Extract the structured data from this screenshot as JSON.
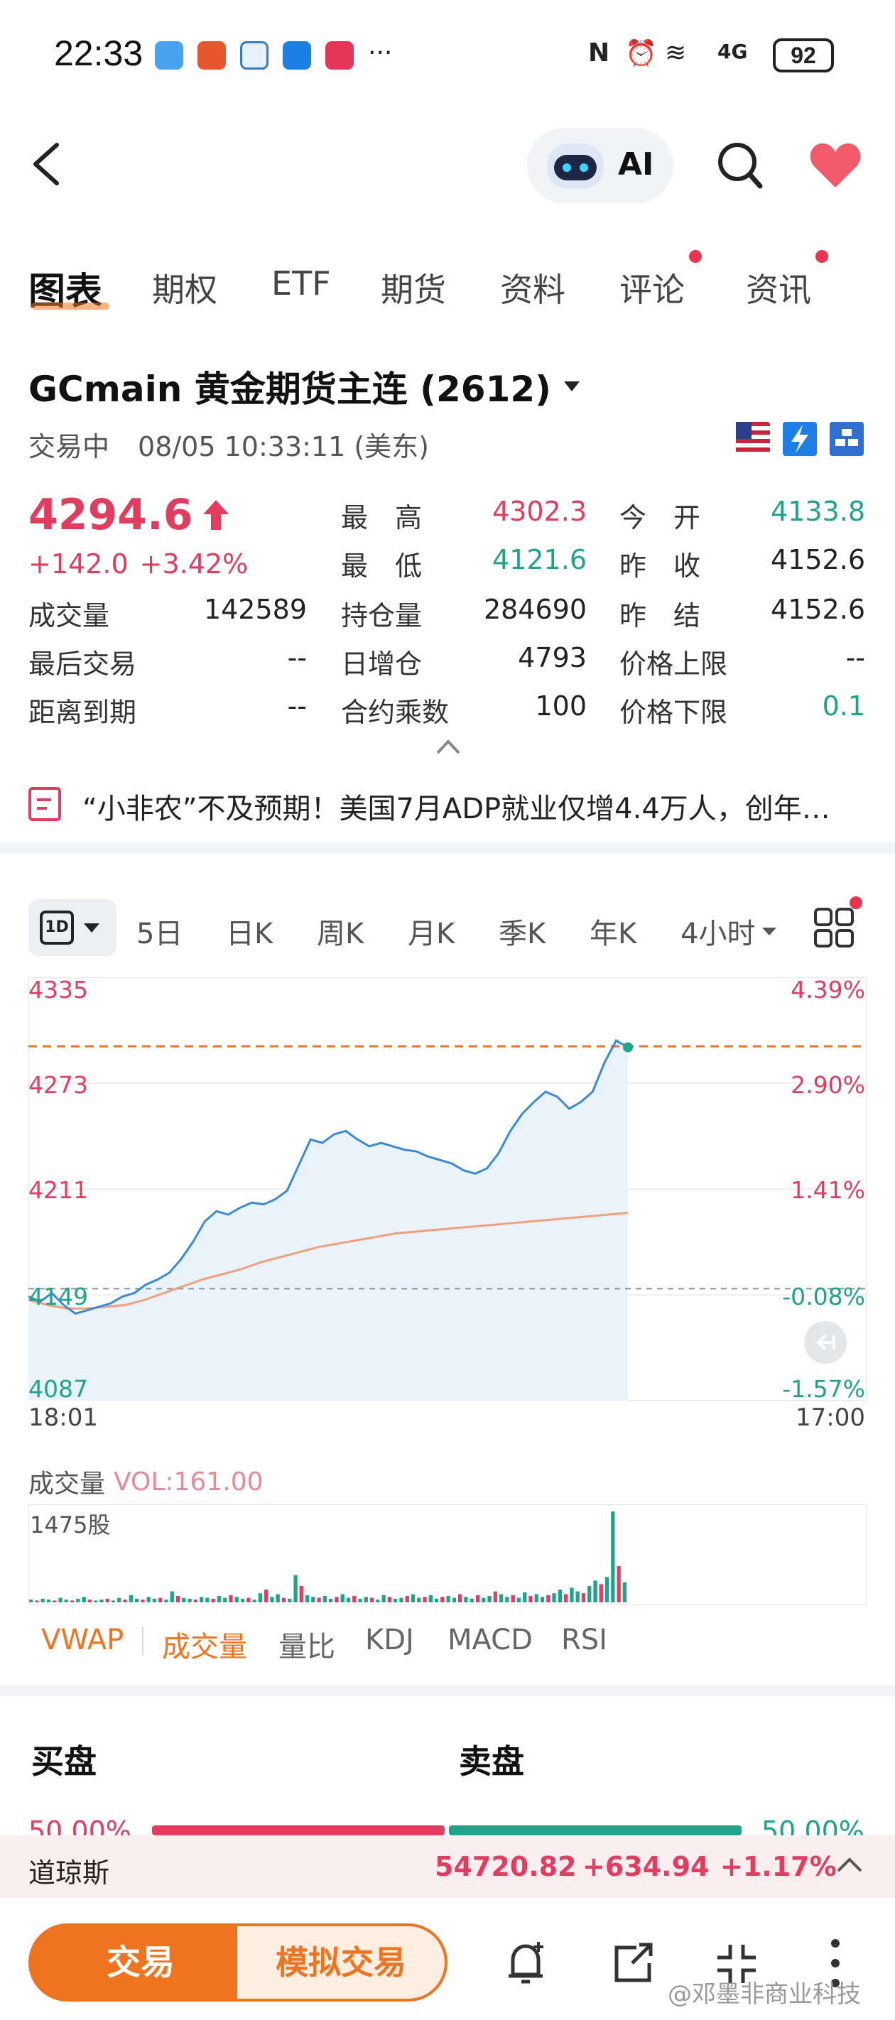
{
  "status_bar": {
    "time": "22:33",
    "battery": "92",
    "signal_text": "4G"
  },
  "nav": {
    "ai_label": "AI"
  },
  "tabs": [
    "图表",
    "期权",
    "ETF",
    "期货",
    "资料",
    "评论",
    "资讯"
  ],
  "instrument": {
    "title": "GCmain  黄金期货主连 (2612)",
    "status": "交易中",
    "datetime": "08/05 10:33:11 (美东)",
    "price": "4294.6",
    "change": "+142.0",
    "change_pct": "+3.42%"
  },
  "quote": {
    "high_label": "最　高",
    "high": "4302.3",
    "open_label": "今　开",
    "open": "4133.8",
    "low_label": "最　低",
    "low": "4121.6",
    "prev_close_label": "昨　收",
    "prev_close": "4152.6",
    "volume_label": "成交量",
    "volume": "142589",
    "oi_label": "持仓量",
    "oi": "284690",
    "prev_settle_label": "昨　结",
    "prev_settle": "4152.6",
    "last_trade_label": "最后交易",
    "last_trade": "--",
    "daily_oi_label": "日增仓",
    "daily_oi": "4793",
    "upper_limit_label": "价格上限",
    "upper_limit": "--",
    "expiry_label": "距离到期",
    "expiry": "--",
    "multiplier_label": "合约乘数",
    "multiplier": "100",
    "lower_limit_label": "价格下限",
    "lower_limit": "0.1"
  },
  "news": {
    "text": "“小非农”不及预期！美国7月ADP就业仅增4.4万人，创年…"
  },
  "periods": {
    "selected": "1D",
    "items": [
      "5日",
      "日K",
      "周K",
      "月K",
      "季K",
      "年K",
      "4小时"
    ]
  },
  "chart_data": {
    "type": "line",
    "y_ticks_left": [
      "4335",
      "4273",
      "4211",
      "4149",
      "4087"
    ],
    "y_ticks_right": [
      "4.39%",
      "2.90%",
      "1.41%",
      "-0.08%",
      "-1.57%"
    ],
    "x_labels": [
      "18:01",
      "17:00"
    ],
    "ylim": [
      4087,
      4335
    ],
    "reference_price": 4152.6,
    "current_price": 4294.6,
    "series": [
      {
        "type": "price",
        "values": [
          4148,
          4145,
          4150,
          4143,
          4138,
          4140,
          4142,
          4144,
          4148,
          4150,
          4155,
          4158,
          4162,
          4170,
          4180,
          4192,
          4198,
          4196,
          4200,
          4203,
          4202,
          4205,
          4210,
          4225,
          4240,
          4238,
          4243,
          4245,
          4240,
          4236,
          4238,
          4236,
          4234,
          4233,
          4230,
          4228,
          4226,
          4222,
          4220,
          4223,
          4232,
          4245,
          4255,
          4262,
          4268,
          4265,
          4258,
          4262,
          4268,
          4285,
          4298,
          4294
        ]
      },
      {
        "type": "average",
        "values": [
          4146,
          4143,
          4141,
          4141,
          4142,
          4143,
          4146,
          4150,
          4154,
          4158,
          4161,
          4164,
          4168,
          4171,
          4174,
          4177,
          4179,
          4181,
          4183,
          4185,
          4186,
          4187,
          4188,
          4189,
          4190,
          4191,
          4192,
          4193,
          4194,
          4195,
          4196,
          4197
        ]
      }
    ]
  },
  "volume": {
    "title": "成交量",
    "vol_label": "VOL:161.00",
    "max_label": "1475股",
    "bars": [
      3,
      2,
      4,
      3,
      2,
      5,
      3,
      2,
      4,
      6,
      3,
      2,
      3,
      4,
      2,
      5,
      3,
      8,
      4,
      3,
      6,
      4,
      5,
      3,
      12,
      7,
      5,
      4,
      3,
      6,
      5,
      4,
      7,
      5,
      8,
      6,
      4,
      5,
      3,
      10,
      14,
      6,
      9,
      5,
      4,
      30,
      18,
      8,
      6,
      5,
      7,
      4,
      6,
      9,
      5,
      7,
      4,
      6,
      5,
      3,
      8,
      6,
      4,
      5,
      7,
      9,
      5,
      6,
      8,
      4,
      6,
      7,
      5,
      9,
      6,
      4,
      8,
      5,
      7,
      12,
      9,
      6,
      8,
      5,
      11,
      7,
      9,
      6,
      8,
      10,
      14,
      9,
      16,
      12,
      10,
      18,
      24,
      20,
      28,
      100,
      40,
      22
    ]
  },
  "indicators": [
    "VWAP",
    "成交量",
    "量比",
    "KDJ",
    "MACD",
    "RSI"
  ],
  "order_book": {
    "buy_label": "买盘",
    "sell_label": "卖盘",
    "buy_pct": "50.00%",
    "sell_pct": "50.00%"
  },
  "ticker": {
    "name": "道琼斯",
    "price": "54720.82",
    "change": "+634.94",
    "change_pct": "+1.17%"
  },
  "bottom": {
    "trade_label": "交易",
    "sim_label": "模拟交易",
    "watermark": "@邓墨非商业科技"
  },
  "colors": {
    "up": "#e23c5f",
    "down": "#1fa48c",
    "accent": "#f07420",
    "line": "#3a8ad8"
  }
}
